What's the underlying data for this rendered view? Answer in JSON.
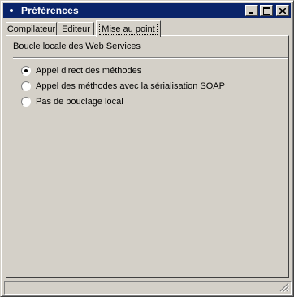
{
  "window": {
    "title": "Préférences"
  },
  "tabs": [
    {
      "label": "Compilateur",
      "active": false
    },
    {
      "label": "Editeur",
      "active": false
    },
    {
      "label": "Mise au point",
      "active": true
    }
  ],
  "group": {
    "title": "Boucle locale des Web Services",
    "options": [
      {
        "label": "Appel direct des méthodes",
        "selected": true
      },
      {
        "label": "Appel des méthodes avec la sérialisation SOAP",
        "selected": false
      },
      {
        "label": "Pas de bouclage local",
        "selected": false
      }
    ]
  },
  "colors": {
    "titlebar": "#0a246a",
    "face": "#d4d0c8"
  },
  "icons": [
    "app-icon",
    "minimize-icon",
    "maximize-icon",
    "close-icon",
    "resize-grip-icon"
  ]
}
